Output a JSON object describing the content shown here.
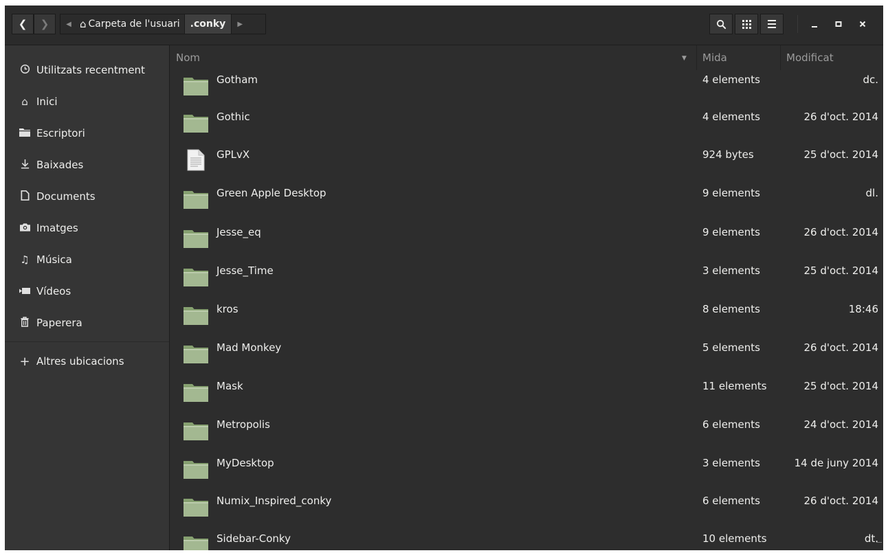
{
  "header": {
    "back_icon": "chevron-left-icon",
    "forward_icon": "chevron-right-icon",
    "path": {
      "home_label": "Carpeta de l'usuari",
      "current_label": ".conky"
    }
  },
  "sidebar": {
    "items": [
      {
        "label": "Utilitzats recentment",
        "icon": "clock-icon"
      },
      {
        "label": "Inici",
        "icon": "home-icon"
      },
      {
        "label": "Escriptori",
        "icon": "desktop-folder-icon"
      },
      {
        "label": "Baixades",
        "icon": "download-icon"
      },
      {
        "label": "Documents",
        "icon": "document-icon"
      },
      {
        "label": "Imatges",
        "icon": "camera-icon"
      },
      {
        "label": "Música",
        "icon": "music-icon"
      },
      {
        "label": "Vídeos",
        "icon": "video-icon"
      },
      {
        "label": "Paperera",
        "icon": "trash-icon"
      },
      {
        "label": "Altres ubicacions",
        "icon": "plus-icon"
      }
    ]
  },
  "columns": {
    "name": "Nom",
    "size": "Mida",
    "modified": "Modificat"
  },
  "files": [
    {
      "name": "Gotham",
      "size": "4 elements",
      "modified": "dc.",
      "type": "folder"
    },
    {
      "name": "Gothic",
      "size": "4 elements",
      "modified": "26 d'oct. 2014",
      "type": "folder"
    },
    {
      "name": "GPLvX",
      "size": "924 bytes",
      "modified": "25 d'oct. 2014",
      "type": "text"
    },
    {
      "name": "Green Apple Desktop",
      "size": "9 elements",
      "modified": "dl.",
      "type": "folder"
    },
    {
      "name": "Jesse_eq",
      "size": "9 elements",
      "modified": "26 d'oct. 2014",
      "type": "folder"
    },
    {
      "name": "Jesse_Time",
      "size": "3 elements",
      "modified": "25 d'oct. 2014",
      "type": "folder"
    },
    {
      "name": "kros",
      "size": "8 elements",
      "modified": "18:46",
      "type": "folder"
    },
    {
      "name": "Mad Monkey",
      "size": "5 elements",
      "modified": "26 d'oct. 2014",
      "type": "folder"
    },
    {
      "name": "Mask",
      "size": "11 elements",
      "modified": "25 d'oct. 2014",
      "type": "folder"
    },
    {
      "name": "Metropolis",
      "size": "6 elements",
      "modified": "24 d'oct. 2014",
      "type": "folder"
    },
    {
      "name": "MyDesktop",
      "size": "3 elements",
      "modified": "14 de juny 2014",
      "type": "folder"
    },
    {
      "name": "Numix_Inspired_conky",
      "size": "6 elements",
      "modified": "26 d'oct. 2014",
      "type": "folder"
    },
    {
      "name": "Sidebar-Conky",
      "size": "10 elements",
      "modified": "dt.",
      "type": "folder"
    }
  ],
  "colors": {
    "folder": "#9db38a",
    "background": "#2d2d2d",
    "sidebar": "#353535"
  }
}
